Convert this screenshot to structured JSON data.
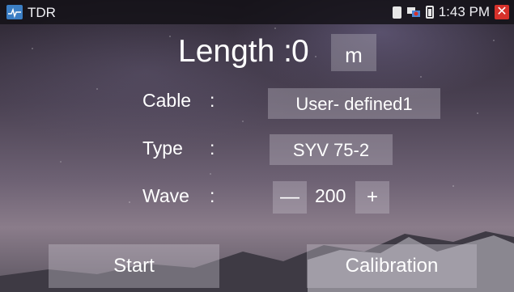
{
  "statusbar": {
    "app_title": "TDR",
    "time": "1:43 PM",
    "close_glyph": "✕",
    "icons": [
      "tdr-app-icon",
      "sd-card-icon",
      "network-icon",
      "battery-icon",
      "close-icon"
    ]
  },
  "length": {
    "label": "Length :",
    "value": "0",
    "unit": "m"
  },
  "cable": {
    "label": "Cable",
    "colon": ":",
    "value": "User- defined1"
  },
  "type": {
    "label": "Type",
    "colon": ":",
    "value": "SYV 75-2"
  },
  "wave": {
    "label": "Wave",
    "colon": ":",
    "decrement": "—",
    "value": "200",
    "increment": "+"
  },
  "actions": {
    "start": "Start",
    "calibration": "Calibration"
  },
  "colors": {
    "close": "#d7312b",
    "app_icon": "#3b7ec4"
  }
}
